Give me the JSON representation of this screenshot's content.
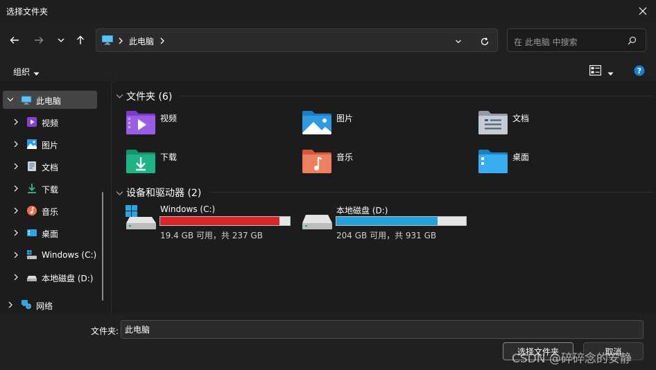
{
  "window": {
    "title": "选择文件夹"
  },
  "address": {
    "path": "此电脑"
  },
  "search": {
    "placeholder": "在 此电脑 中搜索"
  },
  "commandbar": {
    "organize": "组织"
  },
  "sidebar": {
    "items": [
      {
        "label": "此电脑",
        "icon": "pc-icon"
      },
      {
        "label": "视频",
        "icon": "video-icon"
      },
      {
        "label": "图片",
        "icon": "picture-icon"
      },
      {
        "label": "文档",
        "icon": "document-icon"
      },
      {
        "label": "下载",
        "icon": "download-icon"
      },
      {
        "label": "音乐",
        "icon": "music-icon"
      },
      {
        "label": "桌面",
        "icon": "desktop-icon"
      },
      {
        "label": "Windows (C:)",
        "icon": "windows-drive-icon"
      },
      {
        "label": "本地磁盘 (D:)",
        "icon": "drive-icon"
      },
      {
        "label": "网络",
        "icon": "network-icon"
      }
    ]
  },
  "content": {
    "folders_header": "文件夹 (6)",
    "folders": [
      {
        "label": "视频"
      },
      {
        "label": "图片"
      },
      {
        "label": "文档"
      },
      {
        "label": "下载"
      },
      {
        "label": "音乐"
      },
      {
        "label": "桌面"
      }
    ],
    "drives_header": "设备和驱动器 (2)",
    "drives": [
      {
        "name": "Windows (C:)",
        "free": "19.4 GB 可用，共 237 GB",
        "used_fraction": 0.918,
        "bar_color": "#da2626"
      },
      {
        "name": "本地磁盘 (D:)",
        "free": "204 GB 可用，共 931 GB",
        "used_fraction": 0.781,
        "bar_color": "#26a0da"
      }
    ]
  },
  "footer": {
    "folder_label": "文件夹:",
    "folder_value": "此电脑",
    "select_button": "选择文件夹",
    "cancel_button": "取消"
  },
  "watermark": "CSDN @碎碎念的安静",
  "colors": {
    "accent": "#26a0da",
    "danger": "#da2626",
    "help": "#1a7fd4"
  }
}
